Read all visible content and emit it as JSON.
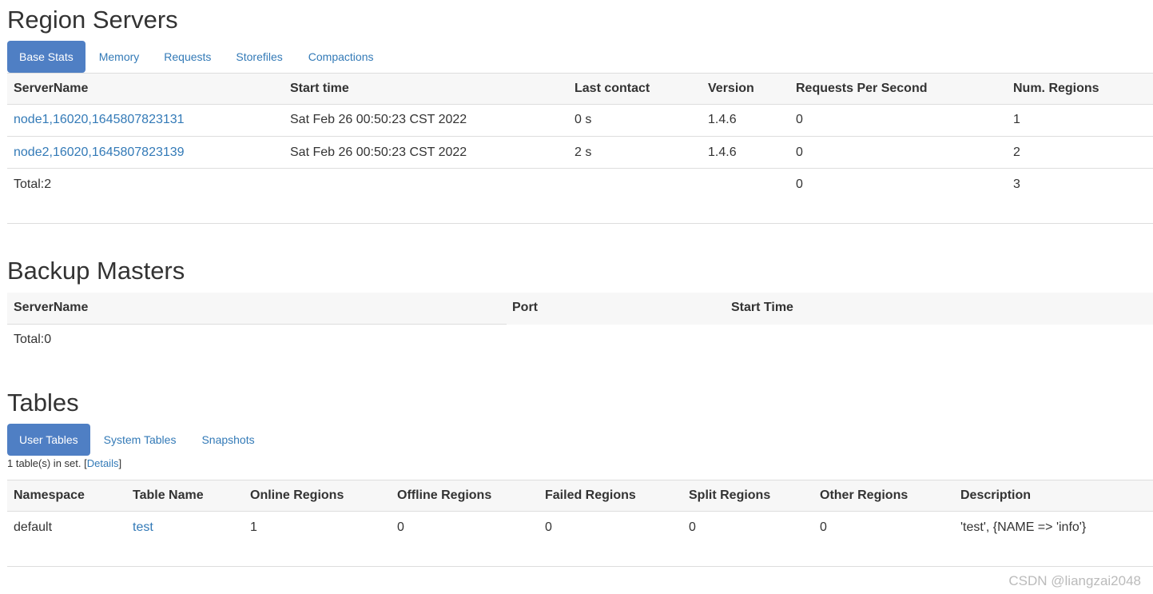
{
  "region_servers": {
    "title": "Region Servers",
    "tabs": [
      "Base Stats",
      "Memory",
      "Requests",
      "Storefiles",
      "Compactions"
    ],
    "columns": [
      "ServerName",
      "Start time",
      "Last contact",
      "Version",
      "Requests Per Second",
      "Num. Regions"
    ],
    "rows": [
      [
        "node1,16020,1645807823131",
        "Sat Feb 26 00:50:23 CST 2022",
        "0 s",
        "1.4.6",
        "0",
        "1"
      ],
      [
        "node2,16020,1645807823139",
        "Sat Feb 26 00:50:23 CST 2022",
        "2 s",
        "1.4.6",
        "0",
        "2"
      ]
    ],
    "total": {
      "label": "Total:2",
      "requests": "0",
      "regions": "3"
    }
  },
  "backup_masters": {
    "title": "Backup Masters",
    "columns": [
      "ServerName",
      "Port",
      "Start Time"
    ],
    "total": "Total:0"
  },
  "tables": {
    "title": "Tables",
    "tabs": [
      "User Tables",
      "System Tables",
      "Snapshots"
    ],
    "summary_prefix": "1 table(s) in set. [",
    "summary_link": "Details",
    "summary_suffix": "]",
    "columns": [
      "Namespace",
      "Table Name",
      "Online Regions",
      "Offline Regions",
      "Failed Regions",
      "Split Regions",
      "Other Regions",
      "Description"
    ],
    "rows": [
      [
        "default",
        "test",
        "1",
        "0",
        "0",
        "0",
        "0",
        "'test', {NAME => 'info'}"
      ]
    ]
  },
  "watermark": "CSDN @liangzai2048",
  "colors": {
    "accent": "#4f7fc4",
    "link": "#337ab7",
    "header_bg": "#f7f7f7",
    "border": "#dddddd"
  }
}
